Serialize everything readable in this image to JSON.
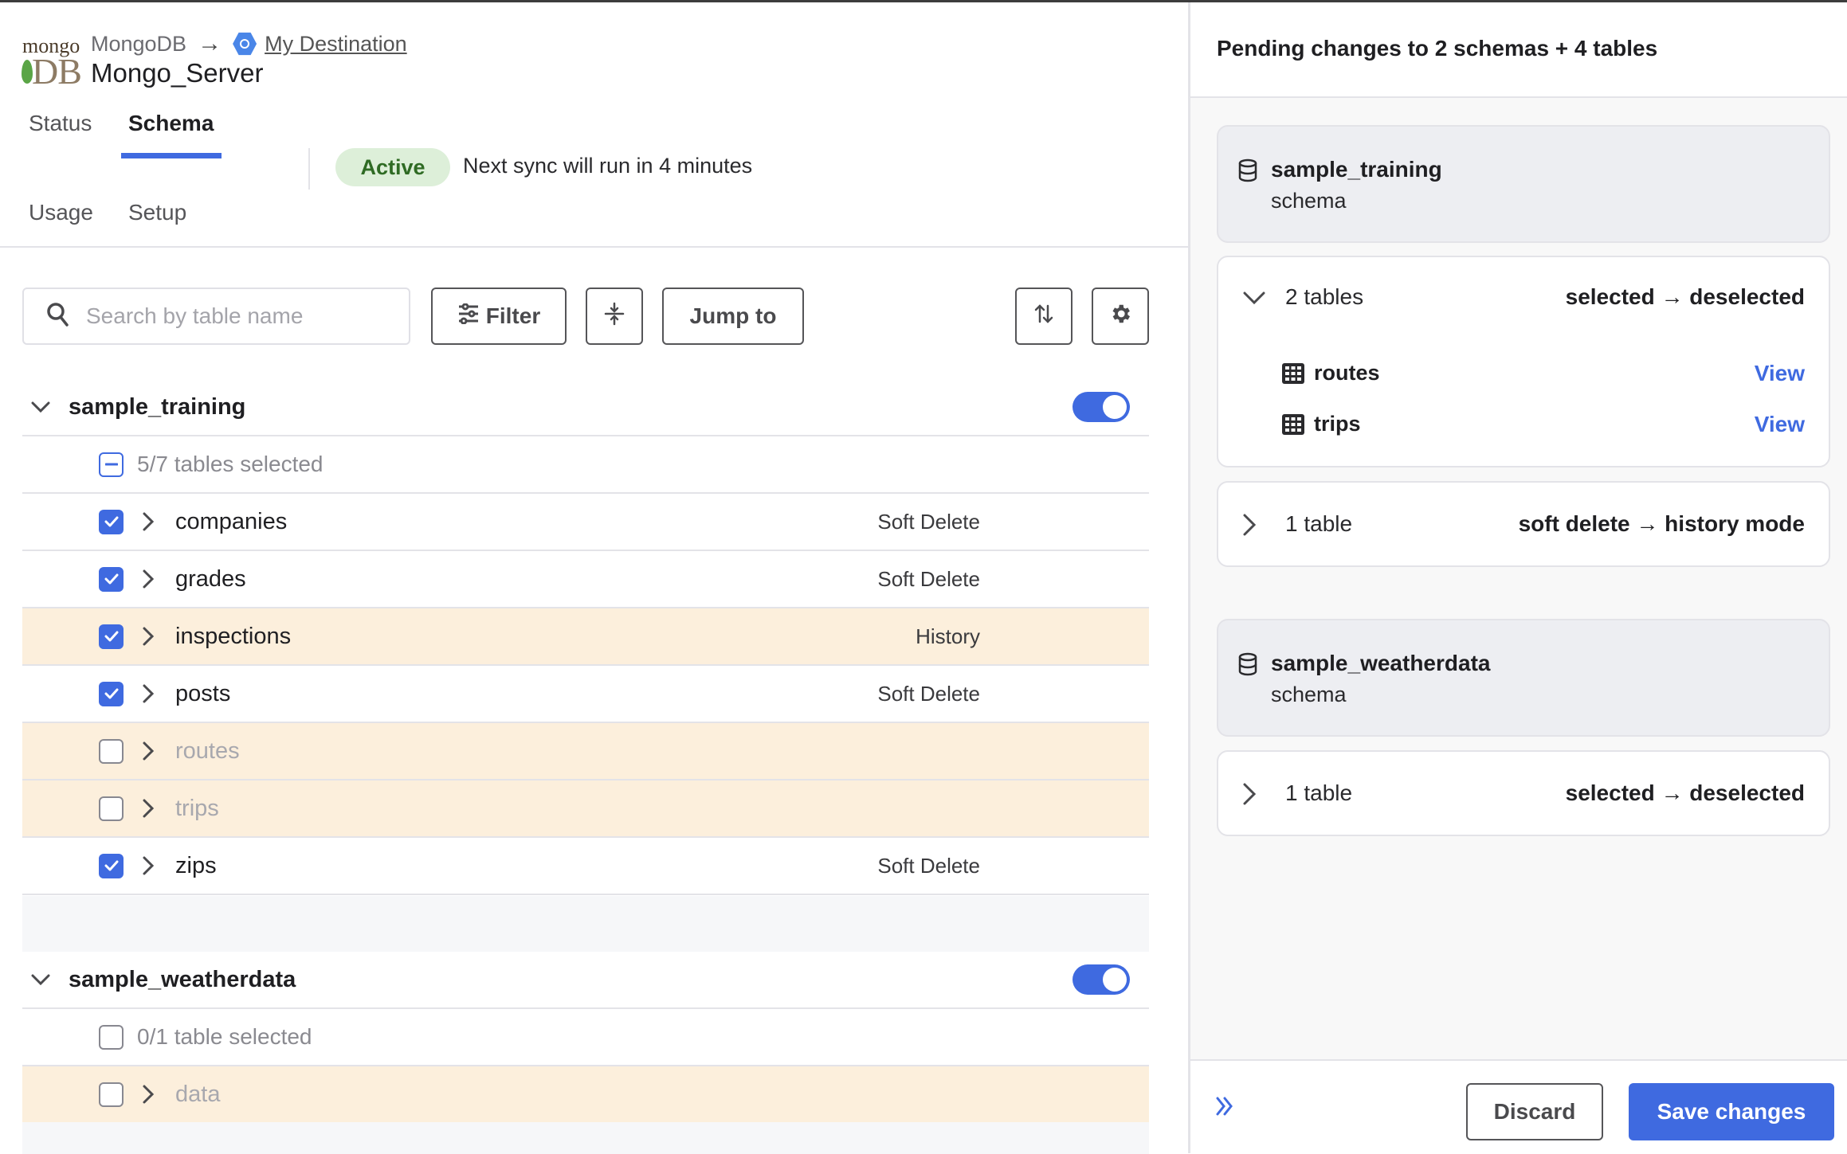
{
  "header": {
    "source_name": "MongoDB",
    "destination_link": "My Destination",
    "connector_title": "Mongo_Server",
    "logo_text_top": "mongo",
    "logo_text_bottom": "DB"
  },
  "tabs": [
    {
      "label": "Status",
      "active": false
    },
    {
      "label": "Schema",
      "active": true
    },
    {
      "label": "Usage",
      "active": false
    },
    {
      "label": "Setup",
      "active": false
    }
  ],
  "status": {
    "badge": "Active",
    "next_sync": "Next sync will run in 4 minutes"
  },
  "toolbar": {
    "search_placeholder": "Search by table name",
    "search_value": "",
    "filter_label": "Filter",
    "jump_to_label": "Jump to"
  },
  "schemas": [
    {
      "name": "sample_training",
      "enabled": true,
      "summary": "5/7 tables selected",
      "summary_state": "partial",
      "tables": [
        {
          "name": "companies",
          "checked": true,
          "mode": "Soft Delete",
          "changed": false
        },
        {
          "name": "grades",
          "checked": true,
          "mode": "Soft Delete",
          "changed": false
        },
        {
          "name": "inspections",
          "checked": true,
          "mode": "History",
          "changed": true
        },
        {
          "name": "posts",
          "checked": true,
          "mode": "Soft Delete",
          "changed": false
        },
        {
          "name": "routes",
          "checked": false,
          "mode": "",
          "changed": true
        },
        {
          "name": "trips",
          "checked": false,
          "mode": "",
          "changed": true
        },
        {
          "name": "zips",
          "checked": true,
          "mode": "Soft Delete",
          "changed": false
        }
      ]
    },
    {
      "name": "sample_weatherdata",
      "enabled": true,
      "summary": "0/1 table selected",
      "summary_state": "unchecked",
      "tables": [
        {
          "name": "data",
          "checked": false,
          "mode": "",
          "changed": true
        }
      ]
    }
  ],
  "pending": {
    "title": "Pending changes to 2 schemas + 4 tables",
    "groups": [
      {
        "schema": "sample_training",
        "schema_sub": "schema",
        "changes": [
          {
            "count": "2 tables",
            "change": "selected → deselected",
            "expanded": true,
            "tables": [
              {
                "name": "routes",
                "action": "View"
              },
              {
                "name": "trips",
                "action": "View"
              }
            ]
          },
          {
            "count": "1 table",
            "change": "soft delete → history mode",
            "expanded": false,
            "tables": []
          }
        ]
      },
      {
        "schema": "sample_weatherdata",
        "schema_sub": "schema",
        "changes": [
          {
            "count": "1 table",
            "change": "selected → deselected",
            "expanded": false,
            "tables": []
          }
        ]
      }
    ],
    "discard_label": "Discard",
    "save_label": "Save changes"
  },
  "colors": {
    "accent": "#3f6ae0",
    "active_badge_bg": "#ddefd9",
    "active_badge_text": "#2f6b24",
    "changed_row_bg": "#fcefdc"
  }
}
